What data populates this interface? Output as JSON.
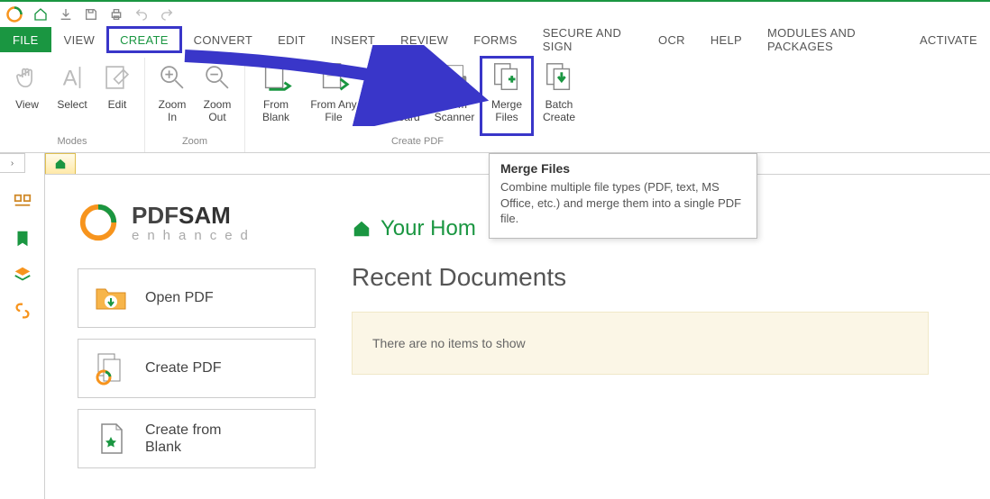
{
  "qat_items": [
    "logo",
    "home",
    "download",
    "save",
    "print",
    "undo",
    "redo"
  ],
  "tabs": [
    {
      "label": "FILE",
      "kind": "file"
    },
    {
      "label": "VIEW"
    },
    {
      "label": "CREATE",
      "kind": "active-highlight"
    },
    {
      "label": "CONVERT"
    },
    {
      "label": "EDIT"
    },
    {
      "label": "INSERT"
    },
    {
      "label": "REVIEW"
    },
    {
      "label": "FORMS"
    },
    {
      "label": "SECURE AND SIGN"
    },
    {
      "label": "OCR"
    },
    {
      "label": "HELP"
    },
    {
      "label": "MODULES AND PACKAGES"
    },
    {
      "label": "ACTIVATE"
    }
  ],
  "ribbon": {
    "groups": [
      {
        "title": "Modes",
        "buttons": [
          {
            "label": "View",
            "icon": "hand"
          },
          {
            "label": "Select",
            "icon": "text-cursor"
          },
          {
            "label": "Edit",
            "icon": "pencil"
          }
        ]
      },
      {
        "title": "Zoom",
        "buttons": [
          {
            "label": "Zoom\nIn",
            "icon": "zoom-in"
          },
          {
            "label": "Zoom\nOut",
            "icon": "zoom-out"
          }
        ]
      },
      {
        "title": "Create PDF",
        "buttons": [
          {
            "label": "From\nBlank",
            "icon": "doc-blank"
          },
          {
            "label": "From Any\nFile",
            "icon": "doc-any"
          },
          {
            "label": "From\nClipboard",
            "icon": "clipboard"
          },
          {
            "label": "From\nScanner",
            "icon": "scanner"
          },
          {
            "label": "Merge\nFiles",
            "icon": "merge",
            "highlight": true
          },
          {
            "label": "Batch\nCreate",
            "icon": "batch"
          }
        ]
      }
    ]
  },
  "tooltip": {
    "title": "Merge Files",
    "body": "Combine multiple file types (PDF, text, MS Office, etc.) and merge them into a single PDF file."
  },
  "brand": {
    "name_a": "PDF",
    "name_b": "SAM",
    "sub": "enhanced"
  },
  "cards": [
    {
      "label": "Open PDF",
      "icon": "folder-open"
    },
    {
      "label": "Create PDF",
      "icon": "doc-create"
    },
    {
      "label": "Create from\nBlank",
      "icon": "doc-blank-star"
    }
  ],
  "home": {
    "your_home": "Your Hom",
    "recent_title": "Recent Documents",
    "empty_msg": "There are no items to show"
  },
  "colors": {
    "green": "#1a9641",
    "orange": "#f7941d",
    "highlight": "#3936c9"
  }
}
